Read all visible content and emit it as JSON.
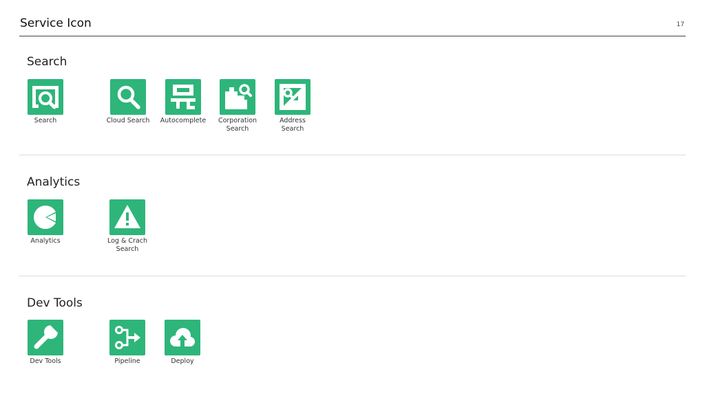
{
  "header": {
    "title": "Service Icon",
    "page_number": "17"
  },
  "colors": {
    "icon_bg": "#2eb57a",
    "icon_fg": "#ffffff"
  },
  "sections": [
    {
      "title": "Search",
      "items": [
        {
          "label": "Search",
          "icon": "search-window-icon"
        },
        {
          "label": "Cloud Search",
          "icon": "magnifier-icon"
        },
        {
          "label": "Autocomplete",
          "icon": "autocomplete-icon"
        },
        {
          "label": "Corporation\nSearch",
          "icon": "corporation-search-icon"
        },
        {
          "label": "Address\nSearch",
          "icon": "address-search-icon"
        }
      ]
    },
    {
      "title": "Analytics",
      "items": [
        {
          "label": "Analytics",
          "icon": "pie-chart-icon"
        },
        {
          "label": "Log & Crach\nSearch",
          "icon": "warning-icon"
        }
      ]
    },
    {
      "title": "Dev Tools",
      "items": [
        {
          "label": "Dev Tools",
          "icon": "wrench-icon"
        },
        {
          "label": "Pipeline",
          "icon": "pipeline-icon"
        },
        {
          "label": "Deploy",
          "icon": "cloud-upload-icon"
        }
      ]
    }
  ]
}
